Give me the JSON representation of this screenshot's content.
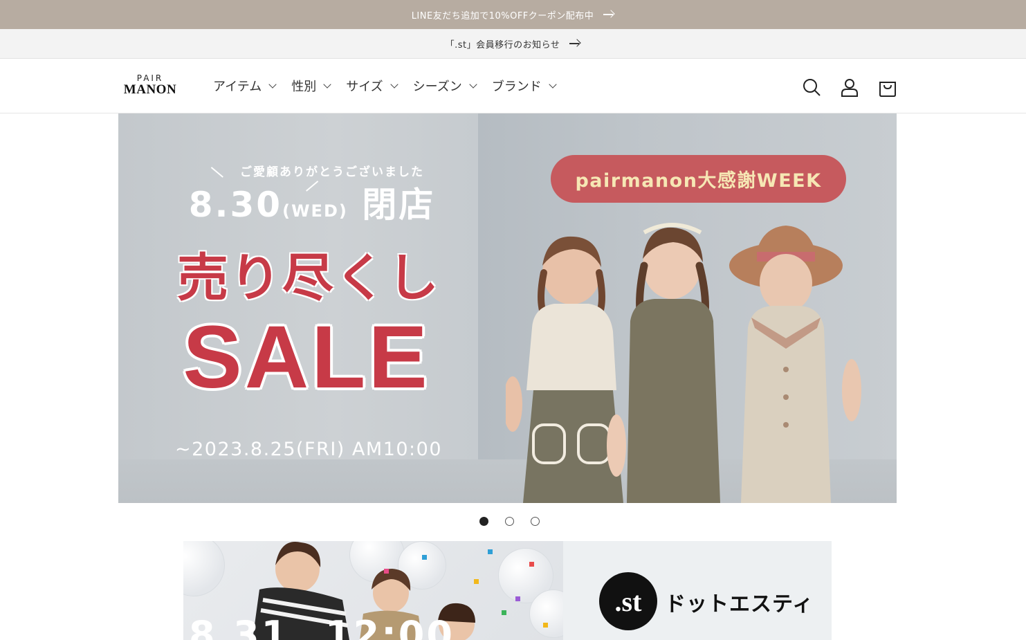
{
  "announcement_bar": {
    "text": "LINE友だち追加で10%OFFクーポン配布中"
  },
  "notice_bar": {
    "text": "「.st」会員移行のお知らせ"
  },
  "header": {
    "logo_top": "PAIR",
    "logo_bottom": "MANON",
    "nav": [
      {
        "label": "アイテム"
      },
      {
        "label": "性別"
      },
      {
        "label": "サイズ"
      },
      {
        "label": "シーズン"
      },
      {
        "label": "ブランド"
      }
    ],
    "icons": [
      "search-icon",
      "account-icon",
      "cart-icon"
    ]
  },
  "hero": {
    "thanks": "ご愛顧ありがとうございました",
    "close_date": "8.30",
    "close_day": "(WED)",
    "close_word": "閉店",
    "sale_jp": "売り尽くし",
    "sale_en": "SALE",
    "until": "~2023.8.25(FRI) AM10:00",
    "week_label": "pairmanon大感謝WEEK",
    "colors": {
      "sale_red": "#c73a47",
      "pill": "#c65a5e",
      "pill_text": "#f6e7b4"
    }
  },
  "carousel": {
    "slides": 3,
    "active_index": 0
  },
  "promo": {
    "date_partial": "8.31",
    "time_partial": "12:00",
    "brand_mark": ".st",
    "brand_name": "ドットエスティ"
  }
}
